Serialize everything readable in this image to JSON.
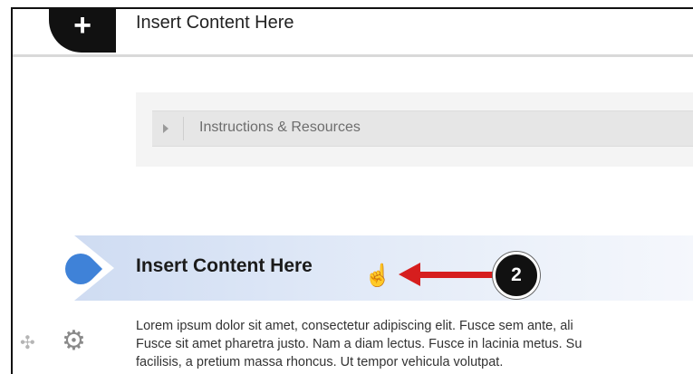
{
  "top_block": {
    "add_symbol": "+",
    "title": "Insert Content Here"
  },
  "resources": {
    "label": "Instructions & Resources"
  },
  "section": {
    "title": "Insert Content Here",
    "step_number": "2",
    "body_lines": [
      "Lorem ipsum dolor sit amet, consectetur adipiscing elit. Fusce sem ante, ali",
      "Fusce sit amet pharetra justo. Nam a diam lectus. Fusce in lacinia metus. Su",
      "facilisis, a pretium massa rhoncus. Ut tempor vehicula volutpat."
    ]
  },
  "icons": {
    "add": "plus-icon",
    "expand": "caret-right-icon",
    "marker": "drop-marker-icon",
    "cursor": "hand-pointer-icon",
    "move": "move-icon",
    "settings": "gear-icon"
  },
  "colors": {
    "marker_blue": "#3f82d8",
    "annotation_red": "#d61e1e",
    "badge_black": "#111111"
  }
}
